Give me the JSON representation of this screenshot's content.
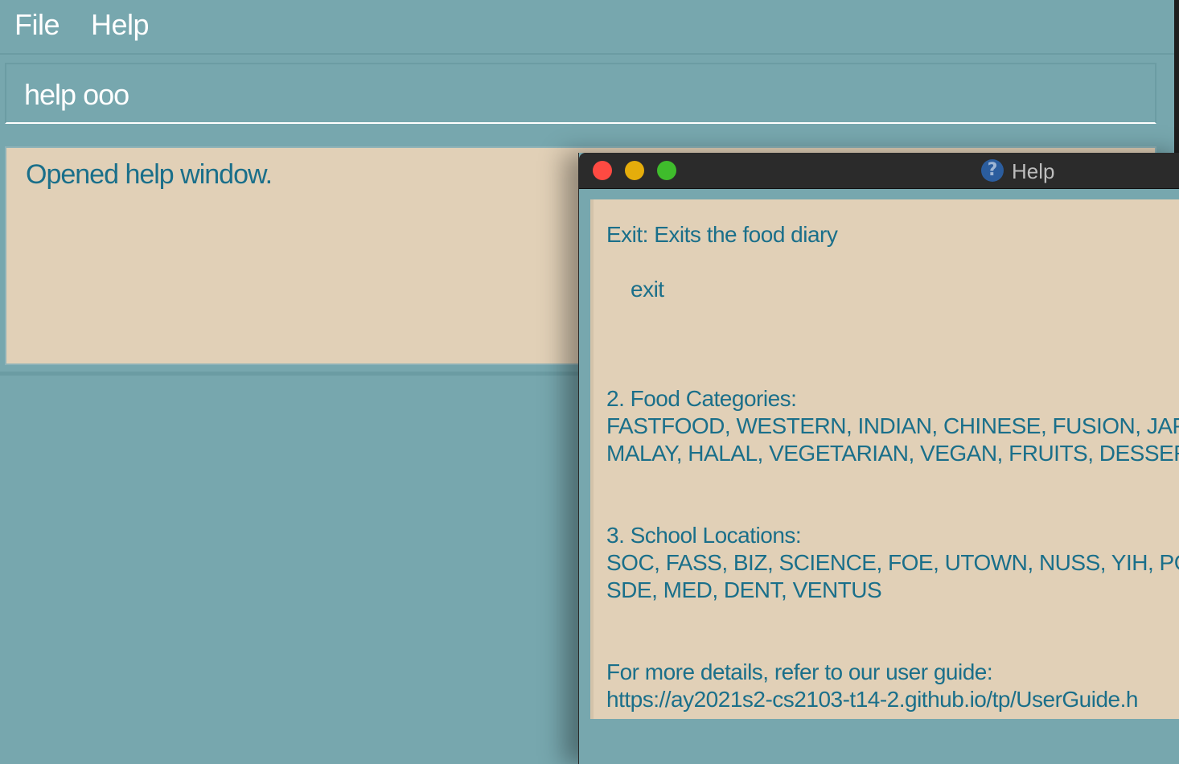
{
  "menu": {
    "file_label": "File",
    "help_label": "Help"
  },
  "command": {
    "value": "help ooo"
  },
  "result": {
    "text": "Opened help window."
  },
  "help_window": {
    "title": "Help",
    "lines": {
      "exit_desc": "Exit: Exits the food diary",
      "exit_cmd": "exit",
      "categories_heading": "2. Food Categories:",
      "categories_line1": "FASTFOOD, WESTERN, INDIAN, CHINESE, FUSION, JAPA",
      "categories_line2": "MALAY, HALAL, VEGETARIAN, VEGAN, FRUITS, DESSER",
      "locations_heading": "3. School Locations:",
      "locations_line1": "SOC, FASS, BIZ, SCIENCE, FOE, UTOWN, NUSS, YIH, PG",
      "locations_line2": "SDE, MED, DENT, VENTUS",
      "details_text": "For more details, refer to our user guide:",
      "details_url": "https://ay2021s2-cs2103-t14-2.github.io/tp/UserGuide.h"
    }
  },
  "colors": {
    "background": "#77a7ae",
    "panel": "#e1d0b7",
    "text_accent": "#1a6f8a",
    "close": "#fe4a42",
    "minimize": "#e5ad0b",
    "maximize": "#3fbc2c"
  },
  "icons": {
    "help_title_icon": "question-icon"
  }
}
